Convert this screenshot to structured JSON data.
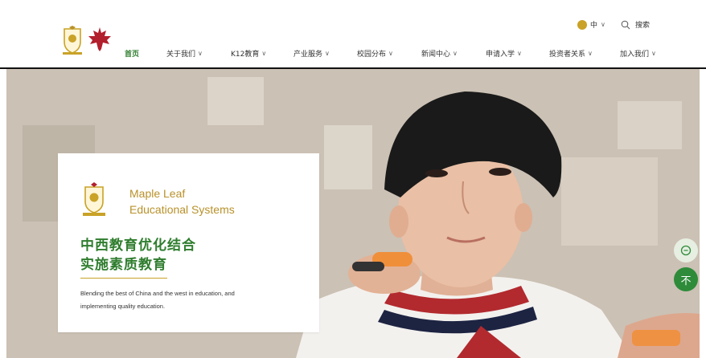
{
  "header": {
    "lang": {
      "label": "中"
    },
    "search": {
      "label": "搜索"
    },
    "nav": [
      {
        "label": "首页",
        "active": true
      },
      {
        "label": "关于我们"
      },
      {
        "label": "K12教育"
      },
      {
        "label": "产业服务"
      },
      {
        "label": "校园分布"
      },
      {
        "label": "新闻中心"
      },
      {
        "label": "申请入学"
      },
      {
        "label": "投资者关系"
      },
      {
        "label": "加入我们"
      }
    ]
  },
  "hero": {
    "brand_line1": "Maple Leaf",
    "brand_line2": "Educational Systems",
    "headline_line1": "中西教育优化结合",
    "headline_line2": "实施素质教育",
    "description_line1": "Blending the best of China and the west in education, and",
    "description_line2": "implementing quality education."
  },
  "floating": {
    "chat_icon": "chat-bubble-icon",
    "top_icon": "back-to-top-icon",
    "top_glyph": "不"
  },
  "colors": {
    "brand_green": "#2f7d2e",
    "brand_gold": "#b8912a",
    "float_green": "#2e8b3a"
  }
}
